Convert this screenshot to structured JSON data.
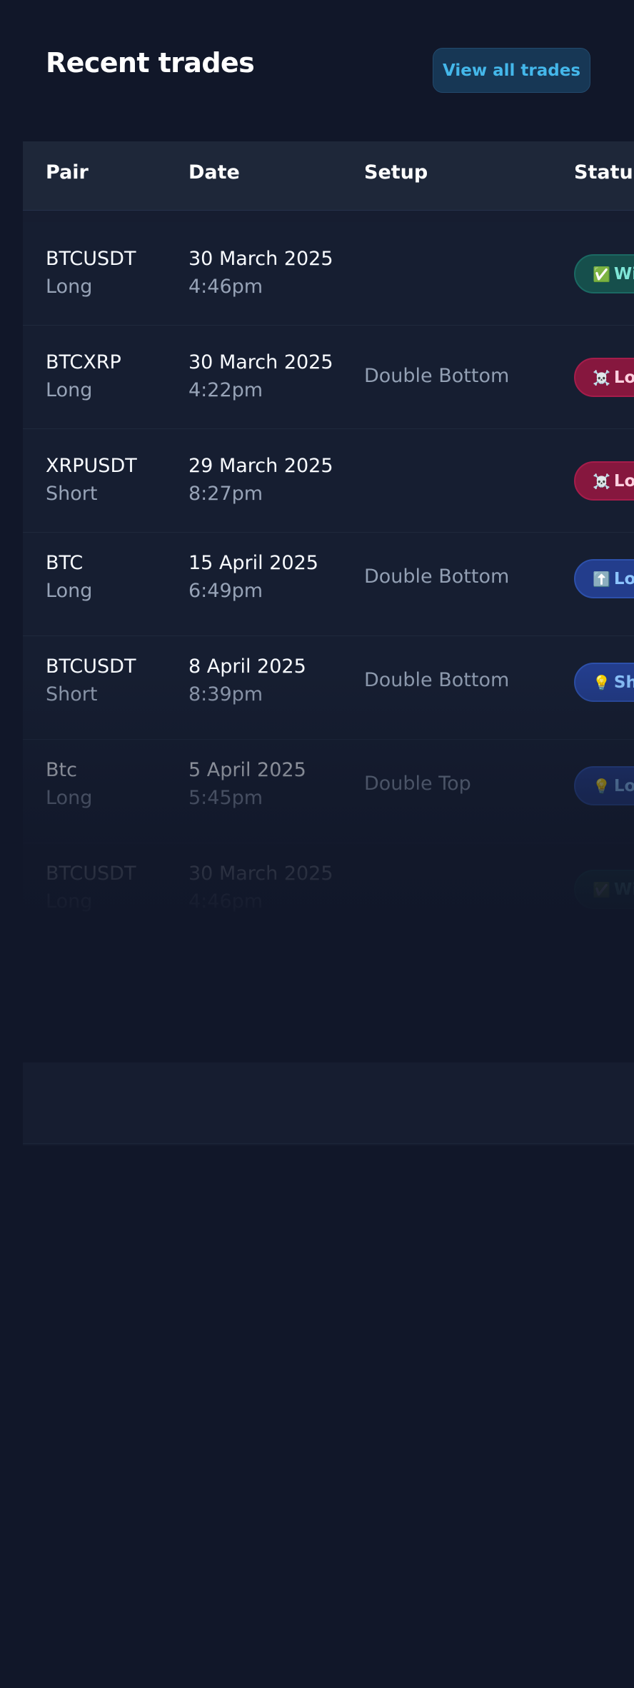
{
  "page": {
    "title": "Recent trades",
    "view_all_label": "View all trades"
  },
  "table": {
    "columns": [
      "Pair",
      "Date",
      "Setup",
      "Status"
    ],
    "rows": [
      {
        "pair": "BTCUSDT",
        "direction": "Long",
        "date": "30 March 2025",
        "time": "4:46pm",
        "setup": "",
        "status": "Win",
        "status_icon": "✅",
        "status_style": "win"
      },
      {
        "pair": "BTCXRP",
        "direction": "Long",
        "date": "30 March 2025",
        "time": "4:22pm",
        "setup": "Double Bottom",
        "status": "Loss",
        "status_icon": "☠️",
        "status_style": "loss"
      },
      {
        "pair": "XRPUSDT",
        "direction": "Short",
        "date": "29 March 2025",
        "time": "8:27pm",
        "setup": "",
        "status": "Loss",
        "status_icon": "☠️",
        "status_style": "loss"
      },
      {
        "pair": "BTC",
        "direction": "Long",
        "date": "15 April 2025",
        "time": "6:49pm",
        "setup": "Double Bottom",
        "status": "Long",
        "status_icon": "⬆️",
        "status_style": "blue"
      },
      {
        "pair": "BTCUSDT",
        "direction": "Short",
        "date": "8 April 2025",
        "time": "8:39pm",
        "setup": "Double Bottom",
        "status": "Short",
        "status_icon": "💡",
        "status_style": "blue"
      },
      {
        "pair": "Btc",
        "direction": "Long",
        "date": "5 April 2025",
        "time": "5:45pm",
        "setup": "Double Top",
        "status": "Long",
        "status_icon": "💡",
        "status_style": "blue"
      },
      {
        "pair": "BTCUSDT",
        "direction": "Long",
        "date": "30 March 2025",
        "time": "4:46pm",
        "setup": "",
        "status": "Win",
        "status_icon": "✅",
        "status_style": "win"
      }
    ]
  }
}
